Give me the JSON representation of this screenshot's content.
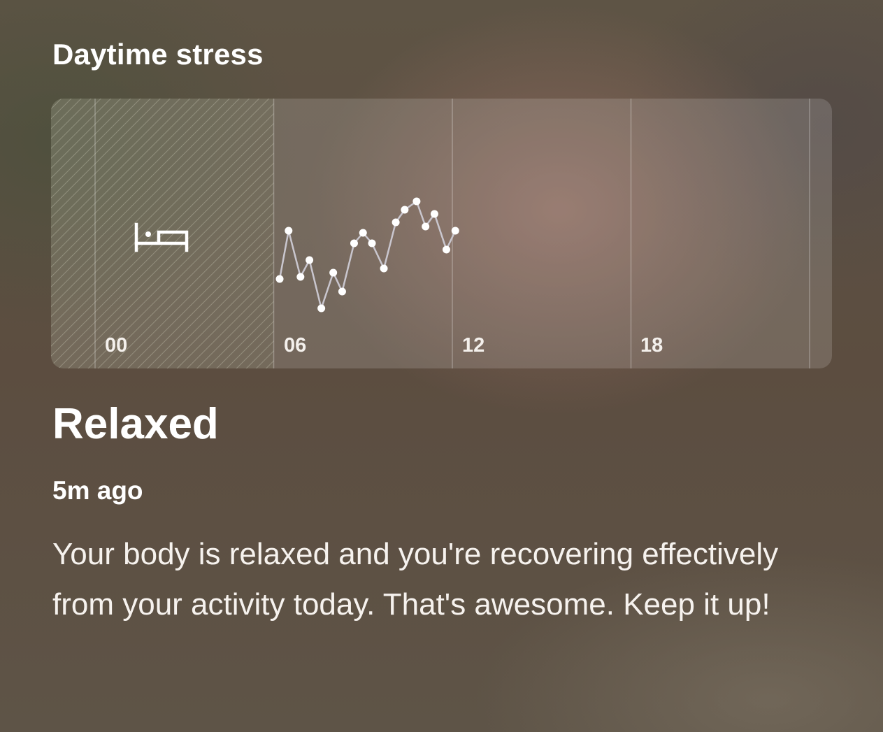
{
  "card": {
    "title": "Daytime stress"
  },
  "chart_data": {
    "type": "line",
    "x_unit": "hour of day",
    "x_range": [
      0,
      24
    ],
    "tick_labels": [
      "00",
      "06",
      "12",
      "18"
    ],
    "sleep_period": {
      "start": 0,
      "end": 6
    },
    "sleep_icon": "bed-icon",
    "y_range": [
      0,
      10
    ],
    "points": [
      {
        "x": 6.2,
        "y": 3.4
      },
      {
        "x": 6.5,
        "y": 5.7
      },
      {
        "x": 6.9,
        "y": 3.5
      },
      {
        "x": 7.2,
        "y": 4.3
      },
      {
        "x": 7.6,
        "y": 2.0
      },
      {
        "x": 8.0,
        "y": 3.7
      },
      {
        "x": 8.3,
        "y": 2.8
      },
      {
        "x": 8.7,
        "y": 5.1
      },
      {
        "x": 9.0,
        "y": 5.6
      },
      {
        "x": 9.3,
        "y": 5.1
      },
      {
        "x": 9.7,
        "y": 3.9
      },
      {
        "x": 10.1,
        "y": 6.1
      },
      {
        "x": 10.4,
        "y": 6.7
      },
      {
        "x": 10.8,
        "y": 7.1
      },
      {
        "x": 11.1,
        "y": 5.9
      },
      {
        "x": 11.4,
        "y": 6.5
      },
      {
        "x": 11.8,
        "y": 4.8
      },
      {
        "x": 12.1,
        "y": 5.7
      }
    ],
    "line_color": "#c9c6ce",
    "point_color": "#ffffff",
    "grid": true
  },
  "status": {
    "label": "Relaxed",
    "updated": "5m ago",
    "description": "Your body is relaxed and you're recovering effectively from your activity today. That's awesome. Keep it up!"
  }
}
